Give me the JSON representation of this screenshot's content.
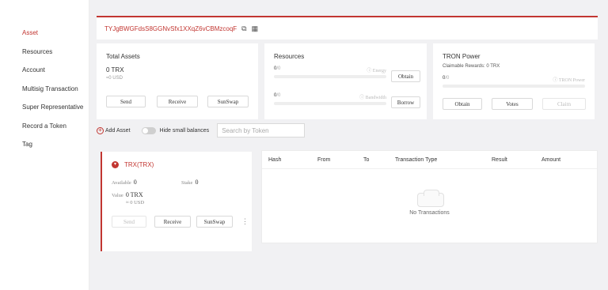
{
  "sidebar": {
    "items": [
      {
        "label": "Asset",
        "active": true
      },
      {
        "label": "Resources"
      },
      {
        "label": "Account"
      },
      {
        "label": "Multisig Transaction"
      },
      {
        "label": "Super Representative"
      },
      {
        "label": "Record a Token"
      },
      {
        "label": "Tag"
      }
    ]
  },
  "header": {
    "address": "TYJgBWGFdsS8GGNvSfx1XXqZ6vCBMzcoqF",
    "copy_icon": "copy-icon",
    "qr_icon": "qr-code-icon"
  },
  "total_assets": {
    "title": "Total Assets",
    "amount": "0 TRX",
    "usd": "≈0 USD",
    "send_label": "Send",
    "receive_label": "Receive",
    "swap_label": "SunSwap"
  },
  "resources": {
    "title": "Resources",
    "energy": {
      "value": "0",
      "max": "/0",
      "label": "Energy",
      "fill": 0
    },
    "bandwidth": {
      "value": "0",
      "max": "/0",
      "label": "Bandwidth",
      "fill": 0
    },
    "obtain_label": "Obtain",
    "borrow_label": "Borrow"
  },
  "tron_power": {
    "title": "TRON Power",
    "claimable": "Claimable Rewards:  0 TRX",
    "value": "0",
    "max": "/0",
    "label": "TRON Power",
    "fill": 0,
    "obtain_label": "Obtain",
    "votes_label": "Votes",
    "claim_label": "Claim"
  },
  "toolbar": {
    "add_asset": "Add Asset",
    "hide_small": "Hide small balances",
    "search_placeholder": "Search by Token"
  },
  "token": {
    "name": "TRX(TRX)",
    "available_label": "Available",
    "available": "0",
    "stake_label": "Stake",
    "stake": "0",
    "value_label": "Value",
    "value": "0  TRX",
    "usd": "≈ 0  USD",
    "send_label": "Send",
    "receive_label": "Receive",
    "swap_label": "SunSwap"
  },
  "transactions": {
    "columns": [
      "Hash",
      "From",
      "To",
      "Transaction Type",
      "Result",
      "Amount"
    ],
    "empty_text": "No Transactions"
  },
  "colors": {
    "accent": "#c23631",
    "background": "#f1f1f3"
  }
}
